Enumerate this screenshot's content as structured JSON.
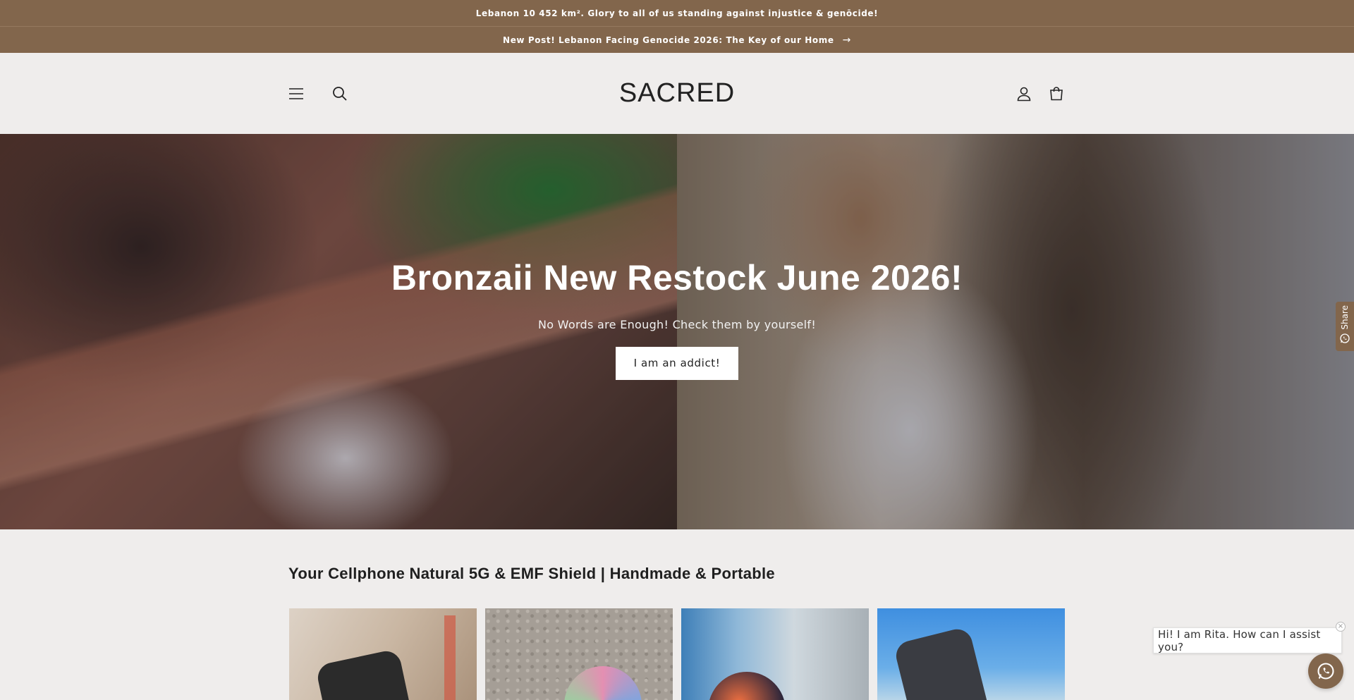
{
  "announcement": {
    "line1": "Lebanon 10 452 km². Glory to all of us standing against injustice & genōcide!",
    "line2": "New Post! Lebanon Facing Genocide 2026: The Key of our Home",
    "line2_arrow": "→"
  },
  "header": {
    "logo": "SACRED",
    "icons": [
      "menu-icon",
      "search-icon",
      "account-icon",
      "cart-icon"
    ]
  },
  "hero": {
    "title": "Bronzaii New Restock June 2026!",
    "subtitle": "No Words are Enough! Check them by yourself!",
    "button_label": "I am an addict!"
  },
  "collection": {
    "title": "Your Cellphone Natural 5G & EMF Shield | Handmade & Portable",
    "products": [
      "product-1",
      "product-2",
      "product-3",
      "product-4"
    ]
  },
  "share": {
    "label": "Share",
    "icon": "whatsapp-icon"
  },
  "chat": {
    "message": "Hi! I am Rita. How can I assist you?",
    "close": "×",
    "icon": "whatsapp-icon"
  },
  "colors": {
    "accent": "#82664c",
    "background": "#efedec"
  }
}
